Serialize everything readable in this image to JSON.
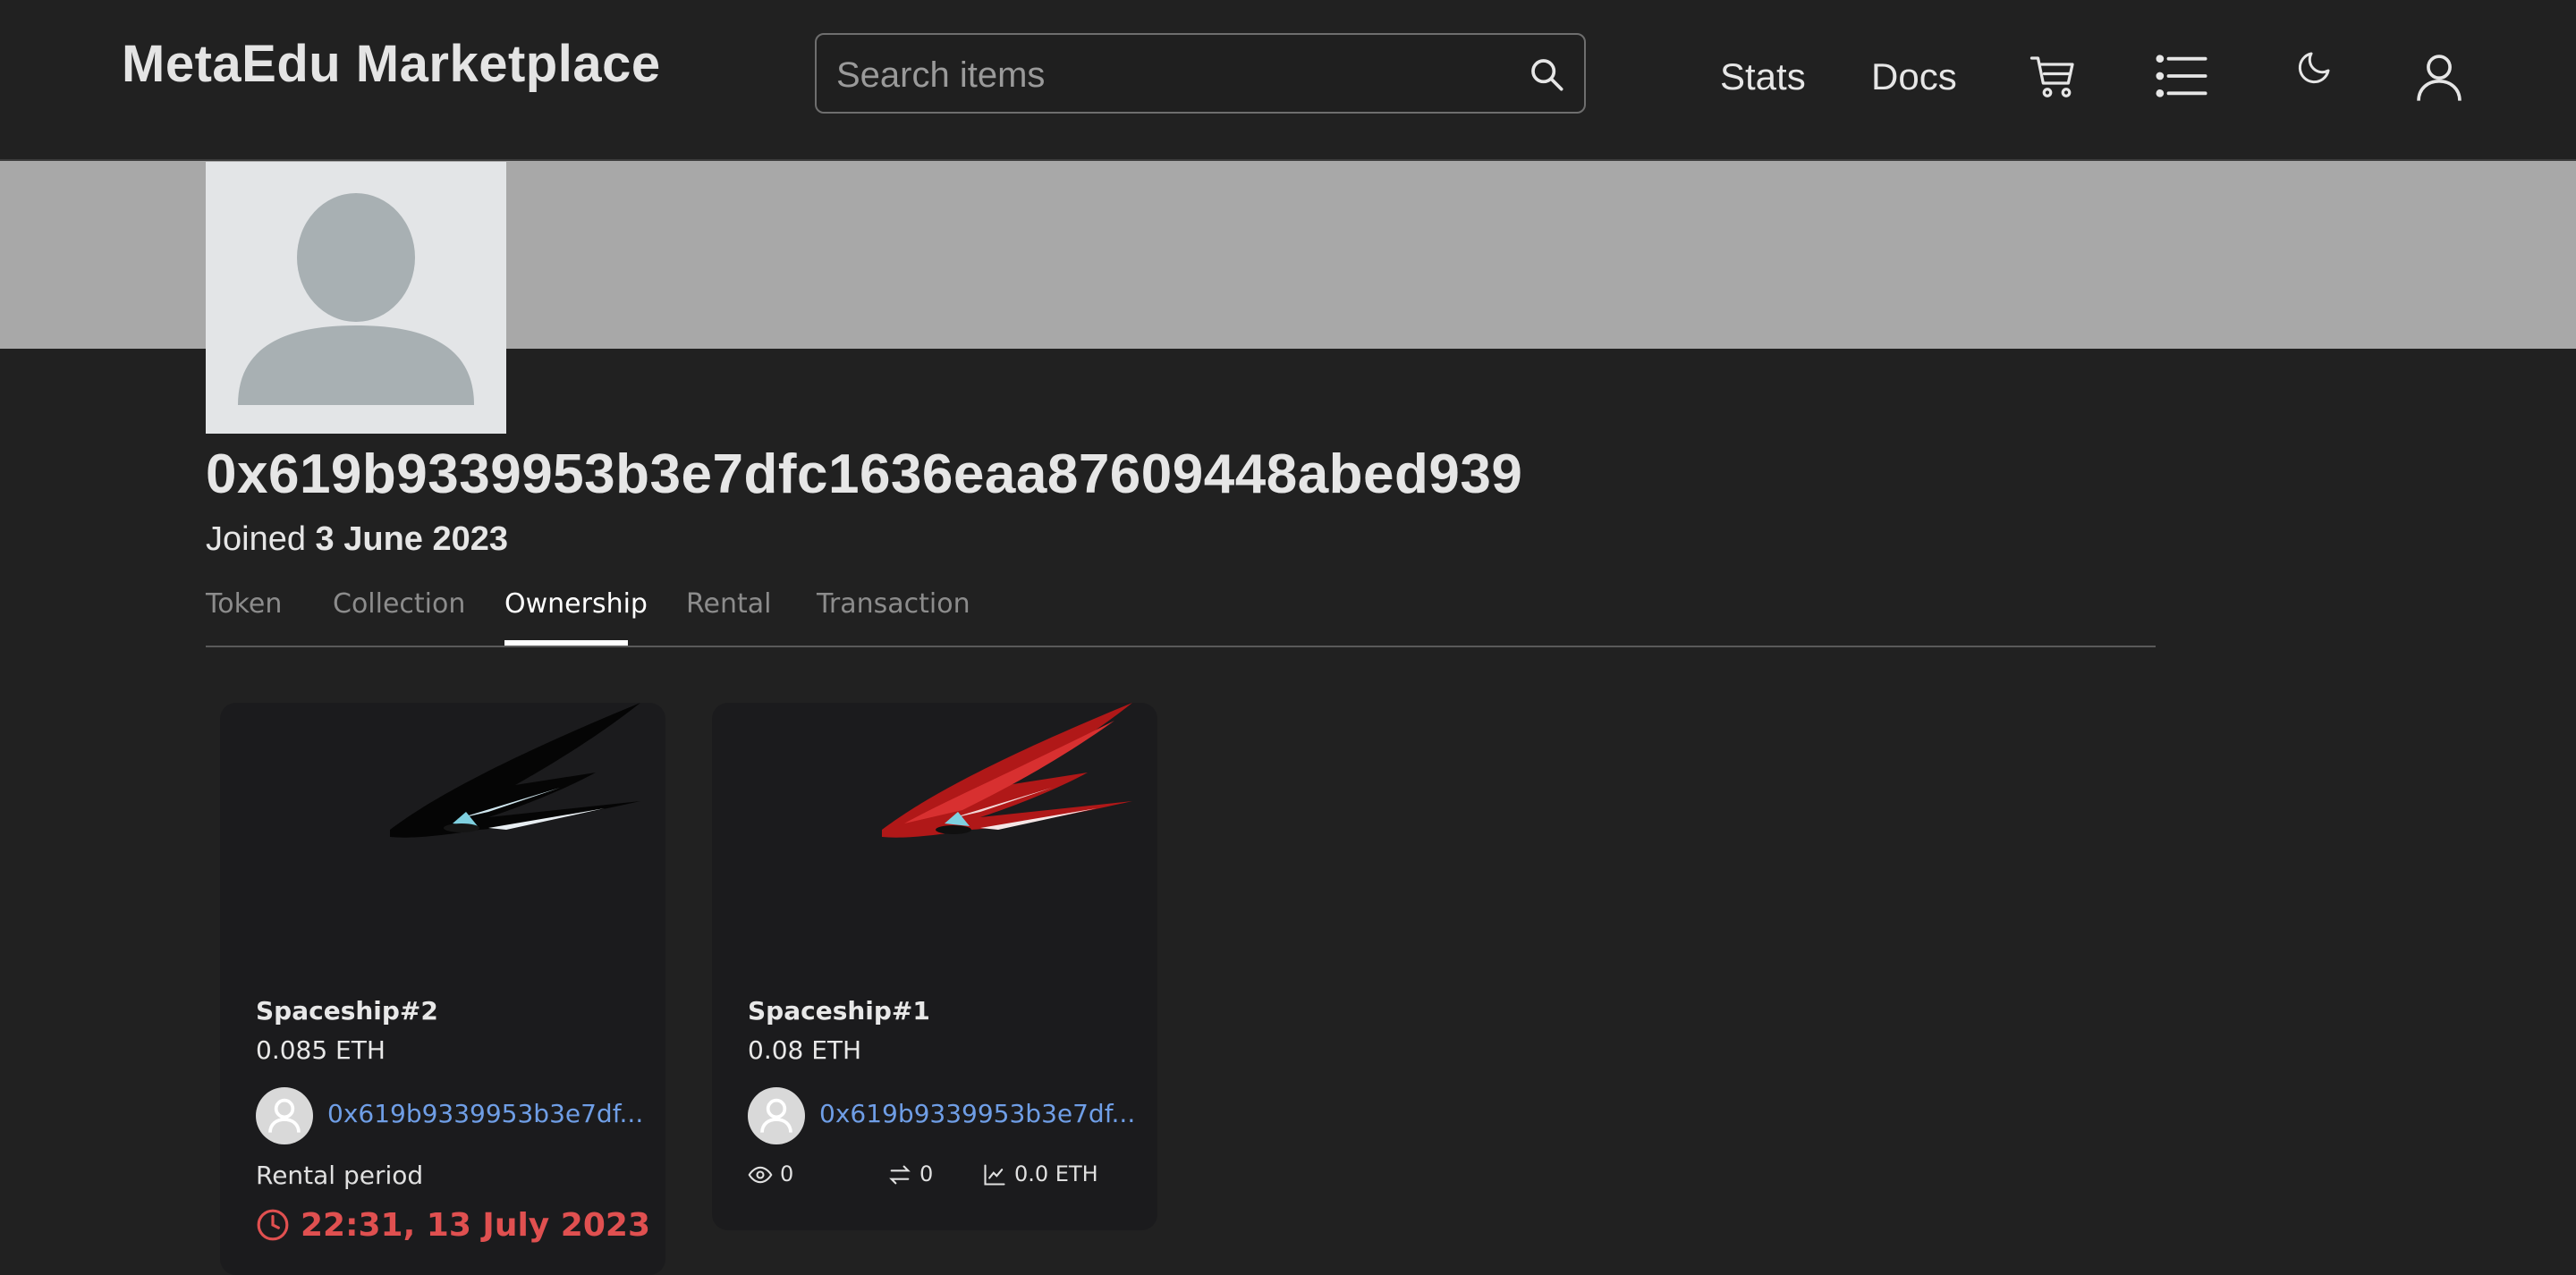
{
  "header": {
    "brand": "MetaEdu Marketplace",
    "search_placeholder": "Search items",
    "nav": {
      "stats": "Stats",
      "docs": "Docs"
    }
  },
  "profile": {
    "address": "0x619b9339953b3e7dfc1636eaa87609448abed939",
    "joined_prefix": "Joined ",
    "joined_date": "3 June 2023"
  },
  "tabs": [
    {
      "label": "Token"
    },
    {
      "label": "Collection"
    },
    {
      "label": "Ownership",
      "active": true
    },
    {
      "label": "Rental"
    },
    {
      "label": "Transaction"
    }
  ],
  "cards": [
    {
      "name": "Spaceship#2",
      "price": "0.085 ETH",
      "owner": "0x619b9339953b3e7df...",
      "rental_label": "Rental period",
      "rental_time": "22:31, 13 July 2023",
      "art_color": "#0a0a0a"
    },
    {
      "name": "Spaceship#1",
      "price": "0.08 ETH",
      "owner": "0x619b9339953b3e7df...",
      "stats": {
        "views": "0",
        "transfers": "0",
        "volume": "0.0 ETH"
      },
      "art_color": "#b01818"
    }
  ],
  "colors": {
    "background": "#212121",
    "banner": "#a8a8a8",
    "link": "#6f9ee6",
    "rental_time": "#e05050"
  }
}
